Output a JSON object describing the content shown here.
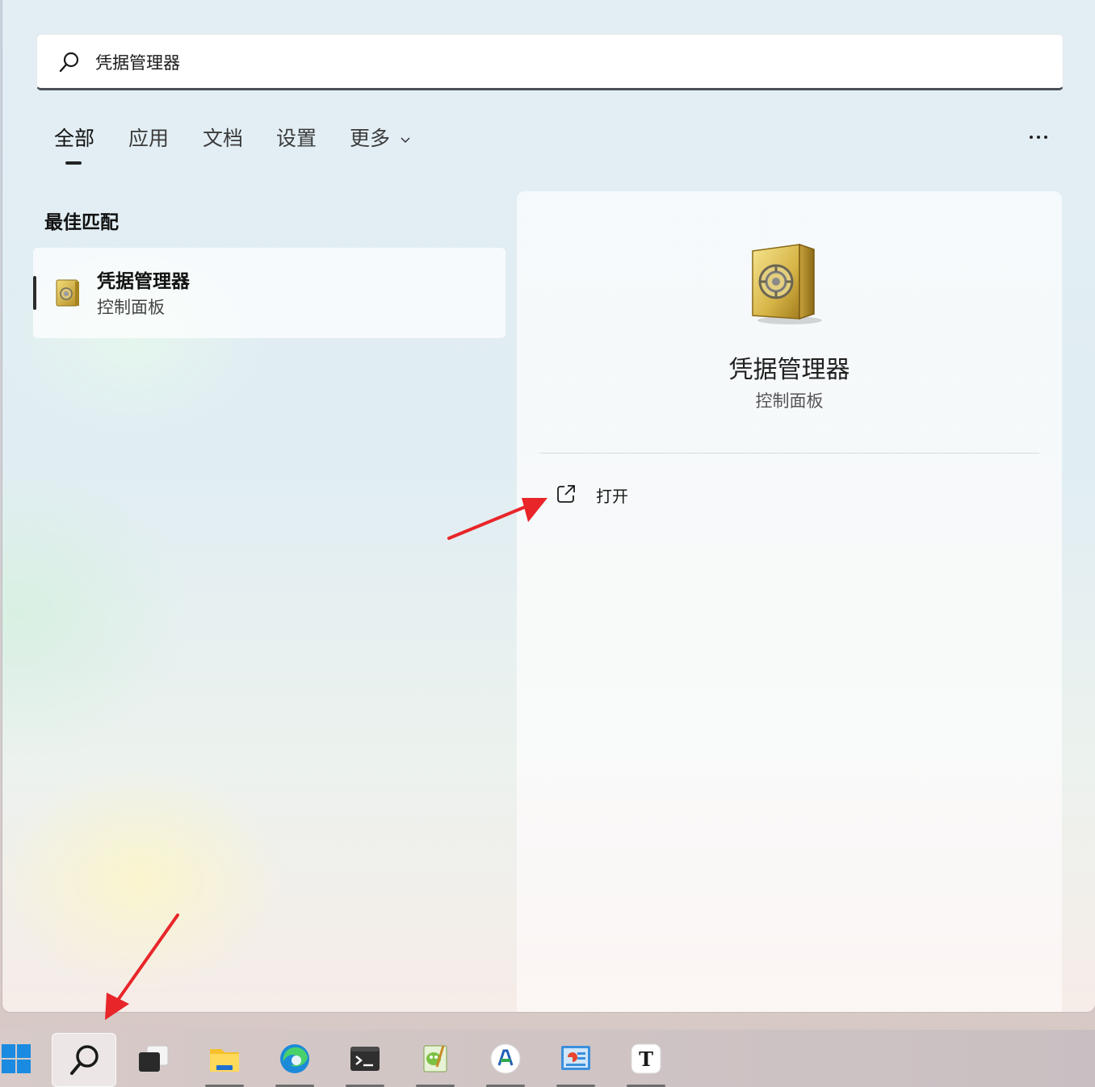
{
  "search": {
    "query": "凭据管理器",
    "icon": "search-icon"
  },
  "tabs": [
    {
      "label": "全部",
      "active": true
    },
    {
      "label": "应用"
    },
    {
      "label": "文档"
    },
    {
      "label": "设置"
    },
    {
      "label": "更多"
    }
  ],
  "more_options_icon": "more-dots-icon",
  "best_match": {
    "section_title": "最佳匹配",
    "item": {
      "name": "凭据管理器",
      "category": "控制面板",
      "icon": "safe-icon"
    }
  },
  "detail": {
    "title": "凭据管理器",
    "subtitle": "控制面板",
    "icon": "safe-icon",
    "actions": [
      {
        "label": "打开",
        "icon": "open-external-icon"
      }
    ]
  },
  "taskbar": {
    "items": [
      {
        "name": "start",
        "icon": "windows-logo-icon"
      },
      {
        "name": "search",
        "icon": "search-icon",
        "active": true
      },
      {
        "name": "task-view",
        "icon": "task-view-icon"
      },
      {
        "name": "file-explorer",
        "icon": "folder-icon"
      },
      {
        "name": "edge",
        "icon": "edge-icon"
      },
      {
        "name": "terminal",
        "icon": "terminal-icon"
      },
      {
        "name": "notepad-plus",
        "icon": "notepad-plus-icon"
      },
      {
        "name": "app-ai",
        "icon": "ai-app-icon"
      },
      {
        "name": "control-panel",
        "icon": "control-panel-icon"
      },
      {
        "name": "typora",
        "icon": "typora-icon"
      }
    ]
  },
  "colors": {
    "annotation_arrow": "#e8262a",
    "accent_dark": "#222222"
  }
}
